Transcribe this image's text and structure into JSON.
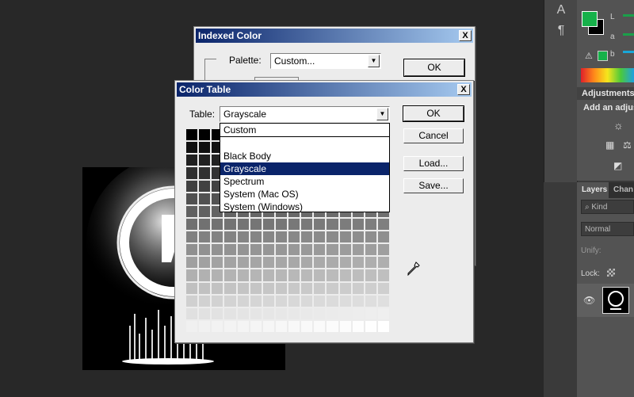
{
  "colors": {
    "canvas_bg": "#282828",
    "dialog_bg": "#ececec",
    "titlebar_start": "#0a246a",
    "titlebar_end": "#a6caf0",
    "selection": "#0a246a",
    "fg_swatch": "#16b14a",
    "bg_swatch": "#000000"
  },
  "tools": {
    "type_icon": "A",
    "paragraph_icon": "¶"
  },
  "color_panel": {
    "l_label": "L",
    "a_label": "a",
    "b_label": "b"
  },
  "adjustments": {
    "title": "Adjustments",
    "add_label": "Add an adjus"
  },
  "layers": {
    "tab_layers": "Layers",
    "tab_channels": "Chan",
    "kind_label": "Kind",
    "blend_mode": "Normal",
    "unify_label": "Unify:",
    "lock_label": "Lock:"
  },
  "indexed_dialog": {
    "title": "Indexed Color",
    "close": "X",
    "palette_label": "Palette:",
    "palette_value": "Custom...",
    "ok": "OK"
  },
  "color_table_dialog": {
    "title": "Color Table",
    "close": "X",
    "table_label": "Table:",
    "table_value": "Grayscale",
    "ok": "OK",
    "cancel": "Cancel",
    "load": "Load...",
    "save": "Save...",
    "options": [
      "Custom",
      "Black Body",
      "Grayscale",
      "Spectrum",
      "System (Mac OS)",
      "System (Windows)"
    ],
    "selected_option": "Grayscale",
    "swatch_count": 256
  }
}
